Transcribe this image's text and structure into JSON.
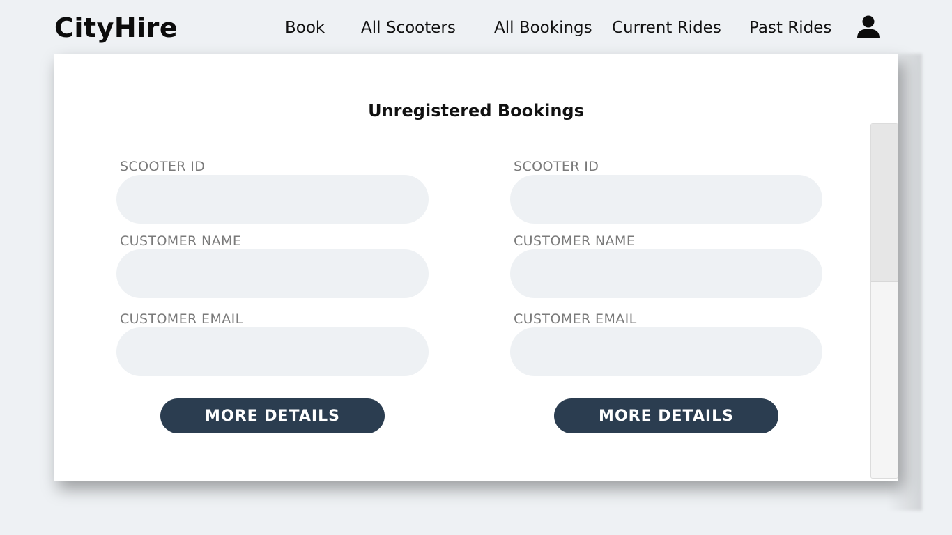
{
  "header": {
    "brand": "CityHire",
    "nav": [
      {
        "label": "Book"
      },
      {
        "label": "All Scooters"
      },
      {
        "label": "All Bookings"
      },
      {
        "label": "Current Rides"
      },
      {
        "label": "Past Rides"
      }
    ],
    "profile_icon": "user-icon"
  },
  "main": {
    "title": "Unregistered Bookings",
    "bookings": [
      {
        "scooter_id_label": "SCOOTER ID",
        "scooter_id_value": "",
        "customer_name_label": "CUSTOMER NAME",
        "customer_name_value": "",
        "customer_email_label": "CUSTOMER EMAIL",
        "customer_email_value": "",
        "button_label": "MORE DETAILS"
      },
      {
        "scooter_id_label": "SCOOTER ID",
        "scooter_id_value": "",
        "customer_name_label": "CUSTOMER NAME",
        "customer_name_value": "",
        "customer_email_label": "CUSTOMER EMAIL",
        "customer_email_value": "",
        "button_label": "MORE DETAILS"
      }
    ]
  },
  "colors": {
    "background": "#eef1f4",
    "panel": "#ffffff",
    "button": "#2b3d50",
    "label": "#7a7a7a"
  }
}
